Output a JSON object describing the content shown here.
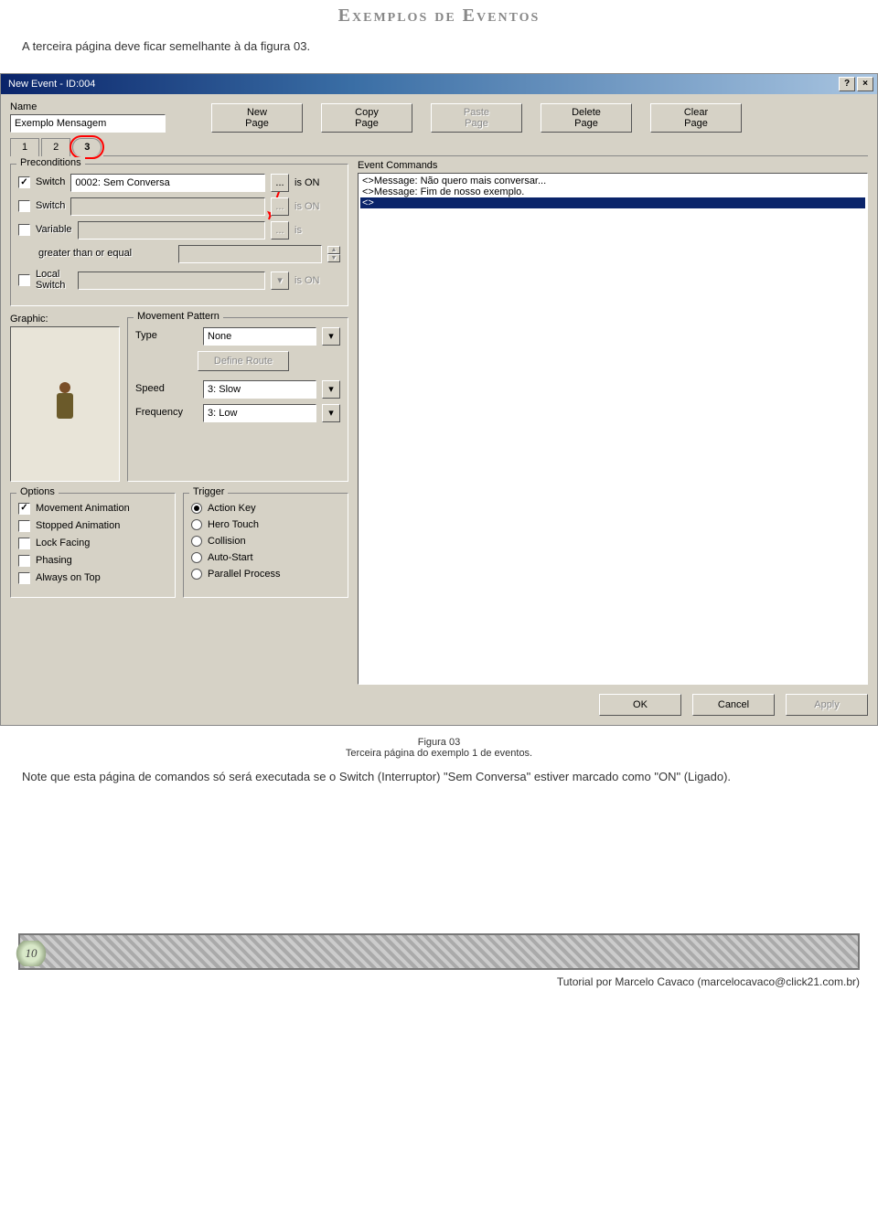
{
  "page_header": {
    "deco_left": "",
    "title": "Exemplos de Eventos",
    "deco_right": ""
  },
  "intro": "A terceira página deve ficar semelhante à da figura 03.",
  "window": {
    "title": "New Event - ID:004",
    "help_btn": "?",
    "close_btn": "×",
    "name_label": "Name",
    "name_value": "Exemplo Mensagem",
    "page_buttons": {
      "new": "New\nPage",
      "copy": "Copy\nPage",
      "paste": "Paste\nPage",
      "delete": "Delete\nPage",
      "clear": "Clear\nPage"
    },
    "tabs": [
      "1",
      "2",
      "3"
    ],
    "selected_tab": "3",
    "preconditions": {
      "legend": "Preconditions",
      "switch1": {
        "label": "Switch",
        "value": "0002: Sem Conversa",
        "state": "is ON",
        "checked": true
      },
      "switch2": {
        "label": "Switch",
        "value": "",
        "state": "is ON",
        "checked": false
      },
      "variable": {
        "label": "Variable",
        "value": "",
        "state": "is",
        "checked": false
      },
      "var_compare": "greater than or equal",
      "local_switch": {
        "label": "Local\nSwitch",
        "value": "",
        "state": "is ON",
        "checked": false
      }
    },
    "graphic_label": "Graphic:",
    "movement": {
      "legend": "Movement Pattern",
      "type_label": "Type",
      "type_value": "None",
      "define_route": "Define Route",
      "speed_label": "Speed",
      "speed_value": "3: Slow",
      "freq_label": "Frequency",
      "freq_value": "3: Low"
    },
    "options": {
      "legend": "Options",
      "items": [
        "Movement Animation",
        "Stopped Animation",
        "Lock Facing",
        "Phasing",
        "Always on Top"
      ],
      "checked": [
        true,
        false,
        false,
        false,
        false
      ]
    },
    "trigger": {
      "legend": "Trigger",
      "items": [
        "Action Key",
        "Hero Touch",
        "Collision",
        "Auto-Start",
        "Parallel Process"
      ],
      "selected": 0
    },
    "event_commands": {
      "legend": "Event Commands",
      "lines": [
        "<>Message: Não quero mais conversar...",
        "<>Message: Fim de nosso exemplo.",
        "<>"
      ],
      "selected_index": 2
    },
    "bottom": {
      "ok": "OK",
      "cancel": "Cancel",
      "apply": "Apply"
    }
  },
  "caption": {
    "line1": "Figura 03",
    "line2": "Terceira página do exemplo 1 de eventos."
  },
  "outro": "Note que esta página de comandos só será executada se o Switch (Interruptor) \"Sem Conversa\" estiver marcado como \"ON\" (Ligado).",
  "footer": {
    "page_number": "10",
    "credit": "Tutorial por Marcelo Cavaco (marcelocavaco@click21.com.br)"
  }
}
